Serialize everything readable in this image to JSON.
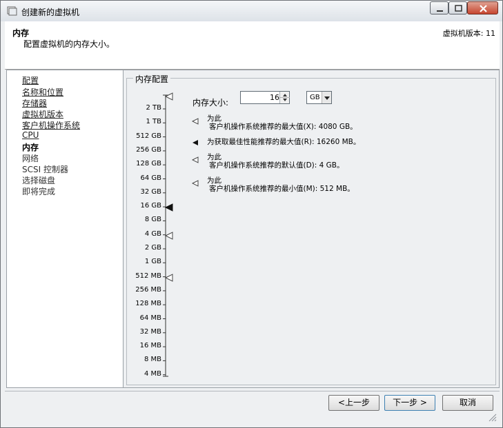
{
  "window": {
    "title": "创建新的虚拟机",
    "icons": {
      "app": "vm-app-icon",
      "minimize": "minimize-icon",
      "maximize": "maximize-icon",
      "close": "close-icon"
    }
  },
  "header": {
    "title": "内存",
    "subtitle": "配置虚拟机的内存大小。",
    "version": "虚拟机版本: 11"
  },
  "sidebar": {
    "items": [
      {
        "label": "配置",
        "state": "link"
      },
      {
        "label": "名称和位置",
        "state": "link"
      },
      {
        "label": "存储器",
        "state": "link"
      },
      {
        "label": "虚拟机版本",
        "state": "link"
      },
      {
        "label": "客户机操作系统",
        "state": "link"
      },
      {
        "label": "CPU",
        "state": "link"
      },
      {
        "label": "内存",
        "state": "current"
      },
      {
        "label": "网络",
        "state": "pending"
      },
      {
        "label": "SCSI 控制器",
        "state": "pending"
      },
      {
        "label": "选择磁盘",
        "state": "pending"
      },
      {
        "label": "即将完成",
        "state": "pending"
      }
    ]
  },
  "memory_config": {
    "group_title": "内存配置",
    "size_label": "内存大小:",
    "size_value": "16",
    "unit": "GB",
    "scale_labels": [
      "2 TB",
      "1 TB",
      "512 GB",
      "256 GB",
      "128 GB",
      "64 GB",
      "32 GB",
      "16 GB",
      "8 GB",
      "4 GB",
      "2 GB",
      "1 GB",
      "512 MB",
      "256 MB",
      "128 MB",
      "64 MB",
      "32 MB",
      "16 MB",
      "8 MB",
      "4 MB"
    ],
    "markers": {
      "guest_max": "4080 GB",
      "best_performance_max": "16260 MB",
      "guest_default": "4 GB",
      "guest_min": "512 MB"
    },
    "legend": [
      {
        "line1": "为此",
        "line2": "客户机操作系统推荐的最大值(X): 4080 GB。",
        "marker": "hollow"
      },
      {
        "line1": "为获取最佳性能推荐的最大值(R): 16260 MB。",
        "line2": "",
        "marker": "solid"
      },
      {
        "line1": "为此",
        "line2": "客户机操作系统推荐的默认值(D): 4 GB。",
        "marker": "hollow"
      },
      {
        "line1": "为此",
        "line2": "客户机操作系统推荐的最小值(M): 512 MB。",
        "marker": "hollow"
      }
    ]
  },
  "buttons": {
    "back": "<上一步",
    "next": "下一步 >",
    "cancel": "取消"
  }
}
